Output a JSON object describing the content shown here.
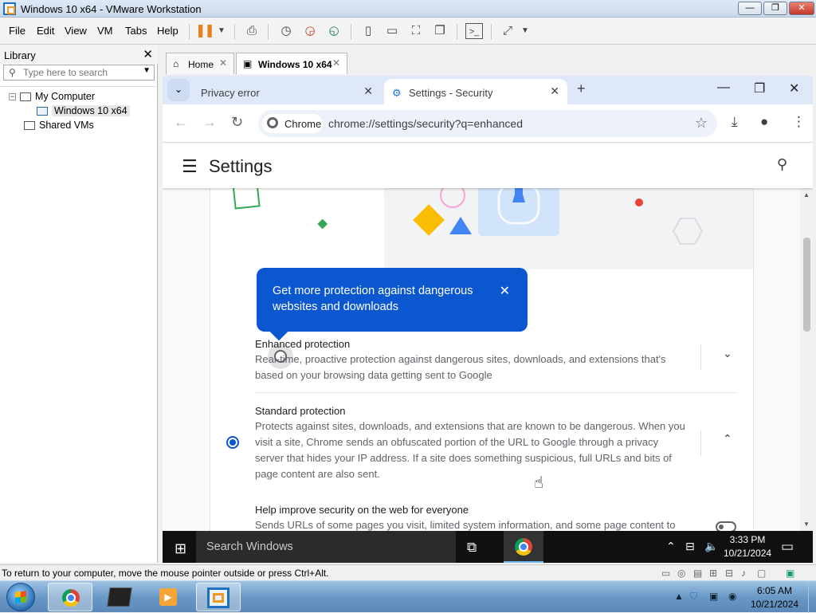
{
  "window": {
    "title": "Windows 10 x64 - VMware Workstation",
    "min": "—",
    "max": "❐",
    "close": "✕"
  },
  "menubar": {
    "items": [
      "File",
      "Edit",
      "View",
      "VM",
      "Tabs",
      "Help"
    ]
  },
  "library": {
    "title": "Library",
    "close": "✕",
    "search_placeholder": "Type here to search",
    "tree": {
      "root": "My Computer",
      "child": "Windows 10 x64",
      "shared": "Shared VMs"
    }
  },
  "vm_tabs": [
    {
      "label": "Home",
      "close": "✕"
    },
    {
      "label": "Windows 10 x64",
      "close": "✕"
    }
  ],
  "chrome": {
    "tabs": [
      {
        "title": "Privacy error",
        "close": "✕"
      },
      {
        "title": "Settings - Security",
        "close": "✕"
      }
    ],
    "new_tab": "+",
    "chip_label": "Chrome",
    "url": "chrome://settings/security?q=enhanced"
  },
  "settings": {
    "title": "Settings",
    "tooltip": "Get more protection against dangerous websites and downloads",
    "tooltip_close": "✕",
    "options": [
      {
        "title": "Enhanced protection",
        "desc": "Real-time, proactive protection against dangerous sites, downloads, and extensions that's based on your browsing data getting sent to Google",
        "selected": false
      },
      {
        "title": "Standard protection",
        "desc": "Protects against sites, downloads, and extensions that are known to be dangerous. When you visit a site, Chrome sends an obfuscated portion of the URL to Google through a privacy server that hides your IP address. If a site does something suspicious, full URLs and bits of page content are also sent.",
        "selected": true
      }
    ],
    "help": {
      "title": "Help improve security on the web for everyone",
      "desc": "Sends URLs of some pages you visit, limited system information, and some page content to"
    }
  },
  "guest_taskbar": {
    "search": "Search Windows",
    "time": "3:33 PM",
    "date": "10/21/2024"
  },
  "status": {
    "text": "To return to your computer, move the mouse pointer outside or press Ctrl+Alt."
  },
  "host_taskbar": {
    "time": "6:05 AM",
    "date": "10/21/2024"
  }
}
